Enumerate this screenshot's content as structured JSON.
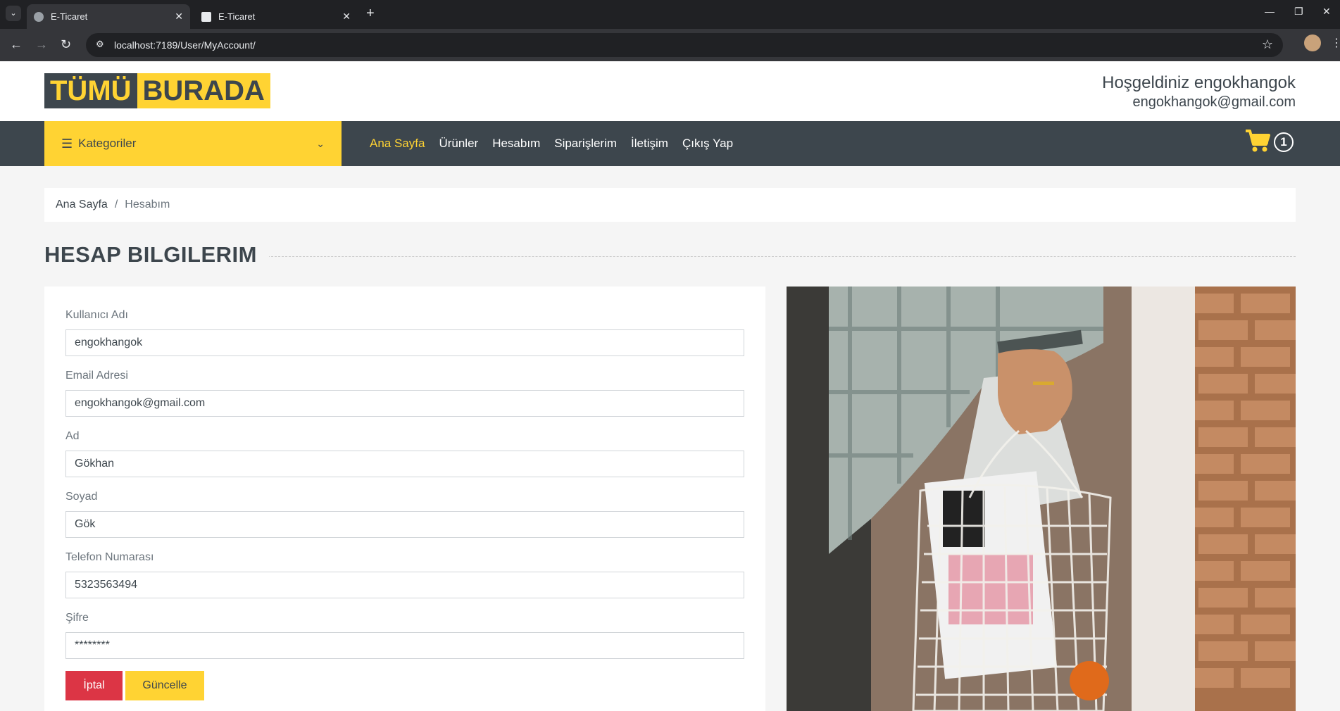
{
  "browser": {
    "tabs": [
      {
        "title": "E-Ticaret",
        "active": true
      },
      {
        "title": "E-Ticaret",
        "active": false
      }
    ],
    "url": "localhost:7189/User/MyAccount/",
    "new_tab_symbol": "+",
    "close_symbol": "✕"
  },
  "header": {
    "logo_part1": "TÜMÜ",
    "logo_part2": "BURADA",
    "welcome_text": "Hoşgeldiniz engokhangok",
    "email": "engokhangok@gmail.com"
  },
  "nav": {
    "categories_label": "Kategoriler",
    "items": [
      {
        "label": "Ana Sayfa",
        "active": true
      },
      {
        "label": "Ürünler",
        "active": false
      },
      {
        "label": "Hesabım",
        "active": false
      },
      {
        "label": "Siparişlerim",
        "active": false
      },
      {
        "label": "İletişim",
        "active": false
      },
      {
        "label": "Çıkış Yap",
        "active": false
      }
    ],
    "cart_count": "1"
  },
  "breadcrumb": {
    "home": "Ana Sayfa",
    "separator": "/",
    "current": "Hesabım"
  },
  "page_title": "HESAP BILGILERIM",
  "form": {
    "fields": [
      {
        "label": "Kullanıcı Adı",
        "value": "engokhangok"
      },
      {
        "label": "Email Adresi",
        "value": "engokhangok@gmail.com"
      },
      {
        "label": "Ad",
        "value": "Gökhan"
      },
      {
        "label": "Soyad",
        "value": "Gök"
      },
      {
        "label": "Telefon Numarası",
        "value": "5323563494"
      },
      {
        "label": "Şifre",
        "value": "********"
      }
    ],
    "cancel_label": "İptal",
    "update_label": "Güncelle"
  },
  "colors": {
    "accent": "#ffd333",
    "dark": "#3d464d",
    "danger": "#dc3545",
    "background": "#f5f5f5"
  },
  "image": {
    "description_icon": "shopping-bag-photo"
  }
}
